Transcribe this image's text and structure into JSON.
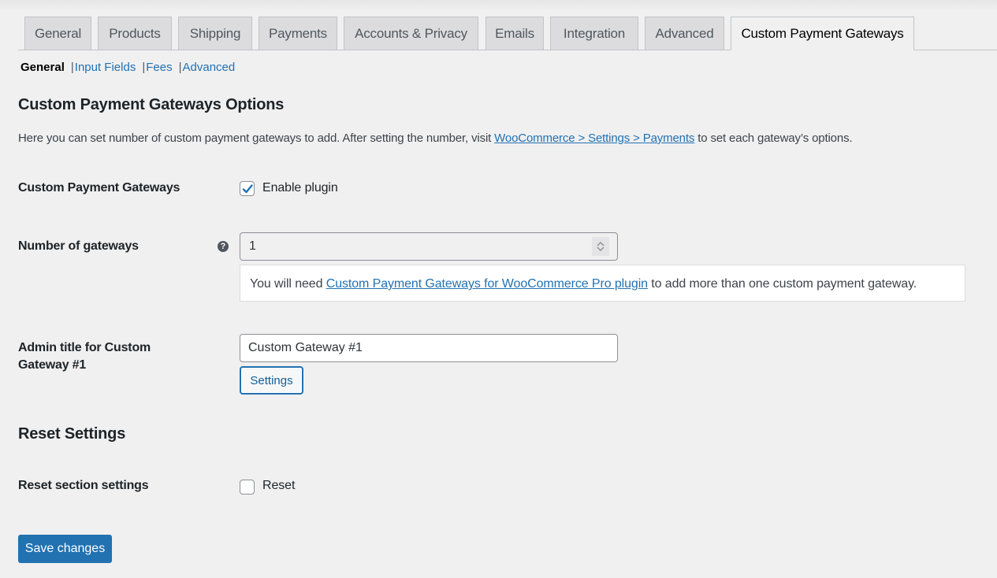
{
  "tabs": [
    {
      "label": "General",
      "active": false
    },
    {
      "label": "Products",
      "active": false
    },
    {
      "label": "Shipping",
      "active": false
    },
    {
      "label": "Payments",
      "active": false
    },
    {
      "label": "Accounts & Privacy",
      "active": false
    },
    {
      "label": "Emails",
      "active": false
    },
    {
      "label": "Integration",
      "active": false
    },
    {
      "label": "Advanced",
      "active": false
    },
    {
      "label": "Custom Payment Gateways",
      "active": true
    }
  ],
  "subnav": {
    "current": "General",
    "separator": "|",
    "links": [
      "Input Fields",
      "Fees",
      "Advanced"
    ]
  },
  "section": {
    "title": "Custom Payment Gateways Options",
    "description_before": "Here you can set number of custom payment gateways to add. After setting the number, visit ",
    "description_link": "WooCommerce > Settings > Payments",
    "description_after": " to set each gateway’s options."
  },
  "fields": {
    "enable": {
      "label": "Custom Payment Gateways",
      "checkbox_label": "Enable plugin",
      "checked": true
    },
    "number": {
      "label": "Number of gateways",
      "help_icon": "question-circle-icon",
      "value": "1",
      "notice_before": "You will need ",
      "notice_link": "Custom Payment Gateways for WooCommerce Pro plugin",
      "notice_after": " to add more than one custom payment gateway."
    },
    "admin_title": {
      "label": "Admin title for Custom Gateway #1",
      "value": "Custom Gateway #1",
      "button_label": "Settings"
    }
  },
  "reset": {
    "title": "Reset Settings",
    "label": "Reset section settings",
    "checkbox_label": "Reset",
    "checked": false
  },
  "footer": {
    "save_label": "Save changes"
  },
  "colors": {
    "accent": "#2271b1",
    "background": "#f0f0f1",
    "tab_inactive": "#dcdcde"
  }
}
